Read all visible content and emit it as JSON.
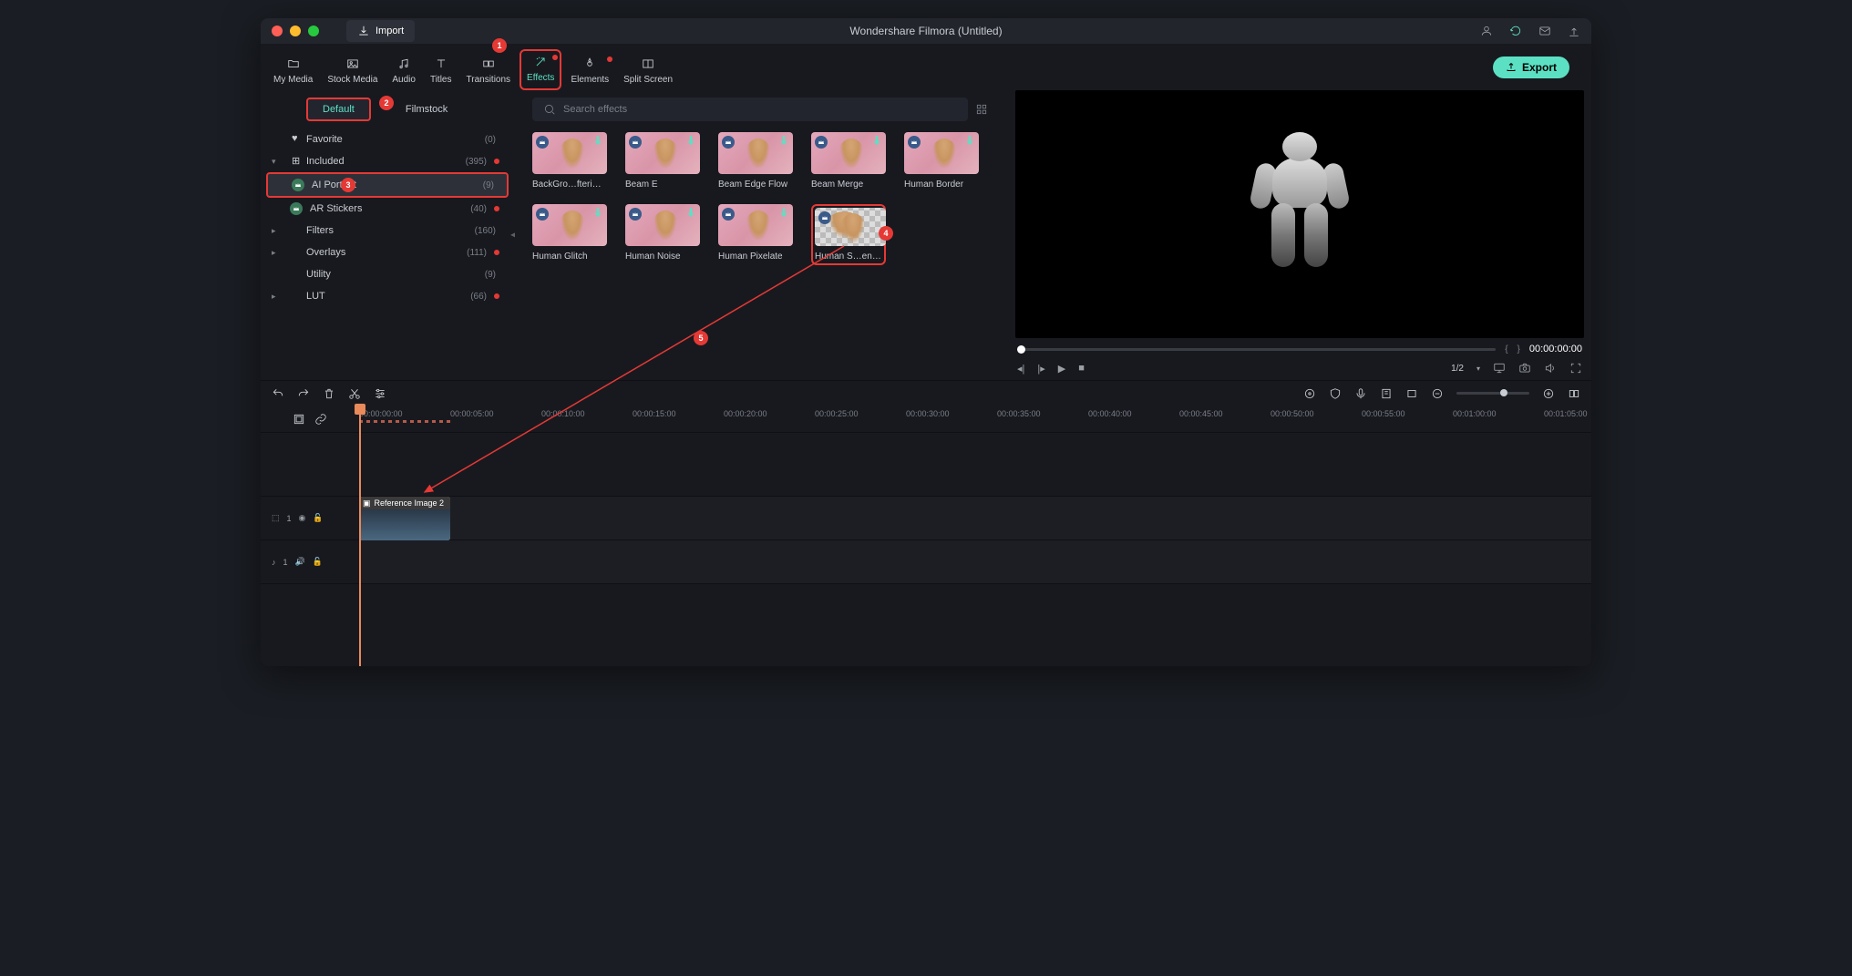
{
  "titlebar": {
    "import_label": "Import",
    "app_title": "Wondershare Filmora (Untitled)"
  },
  "tabs": [
    {
      "label": "My Media",
      "icon": "folder"
    },
    {
      "label": "Stock Media",
      "icon": "image"
    },
    {
      "label": "Audio",
      "icon": "audio"
    },
    {
      "label": "Titles",
      "icon": "text"
    },
    {
      "label": "Transitions",
      "icon": "transition"
    },
    {
      "label": "Effects",
      "icon": "wand",
      "active": true,
      "badge": true
    },
    {
      "label": "Elements",
      "icon": "elements",
      "badge": true
    },
    {
      "label": "Split Screen",
      "icon": "split"
    }
  ],
  "export_label": "Export",
  "sidebar_tabs": {
    "default": "Default",
    "filmstock": "Filmstock"
  },
  "sidebar": [
    {
      "label": "Favorite",
      "count": "(0)",
      "indent": 0,
      "icon": "heart"
    },
    {
      "label": "Included",
      "count": "(395)",
      "indent": 0,
      "exp": true,
      "dot": true,
      "icon": "grid"
    },
    {
      "label": "AI Portrait",
      "count": "(9)",
      "indent": 1,
      "icon": "crown",
      "selected": true
    },
    {
      "label": "AR Stickers",
      "count": "(40)",
      "indent": 1,
      "icon": "crown",
      "dot": true
    },
    {
      "label": "Filters",
      "count": "(160)",
      "indent": 0,
      "chev": true
    },
    {
      "label": "Overlays",
      "count": "(111)",
      "indent": 0,
      "chev": true,
      "dot": true
    },
    {
      "label": "Utility",
      "count": "(9)",
      "indent": 0
    },
    {
      "label": "LUT",
      "count": "(66)",
      "indent": 0,
      "chev": true,
      "dot": true
    }
  ],
  "search_placeholder": "Search effects",
  "effects": [
    {
      "name": "BackGro…fterimage"
    },
    {
      "name": "Beam E"
    },
    {
      "name": "Beam Edge Flow"
    },
    {
      "name": "Beam Merge"
    },
    {
      "name": "Human Border"
    },
    {
      "name": "Human Glitch"
    },
    {
      "name": "Human Noise"
    },
    {
      "name": "Human Pixelate"
    },
    {
      "name": "Human S…entation",
      "highlighted": true,
      "checker": true
    }
  ],
  "preview": {
    "markers": {
      "in": "{",
      "out": "}"
    },
    "time": "00:00:00:00",
    "ratio": "1/2"
  },
  "timeline": {
    "times": [
      "00:00:00:00",
      "00:00:05:00",
      "00:00:10:00",
      "00:00:15:00",
      "00:00:20:00",
      "00:00:25:00",
      "00:00:30:00",
      "00:00:35:00",
      "00:00:40:00",
      "00:00:45:00",
      "00:00:50:00",
      "00:00:55:00",
      "00:01:00:00",
      "00:01:05:00"
    ],
    "video_track": {
      "name": "1",
      "clip_label": "Reference Image 2"
    },
    "audio_track": {
      "name": "1"
    }
  },
  "annotations": {
    "n1": "1",
    "n2": "2",
    "n3": "3",
    "n4": "4",
    "n5": "5"
  }
}
